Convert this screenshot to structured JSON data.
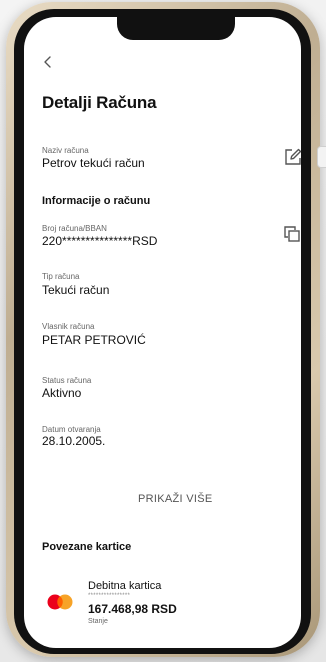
{
  "header": {
    "title": "Detalji Računa"
  },
  "account_name": {
    "label": "Naziv računa",
    "value": "Petrov tekući račun"
  },
  "info_section": {
    "title": "Informacije o računu",
    "fields": [
      {
        "label": "Broj računa/BBAN",
        "value": "220***************RSD"
      },
      {
        "label": "Tip računa",
        "value": "Tekući račun"
      },
      {
        "label": "Vlasnik računa",
        "value": "PETAR PETROVIĆ"
      },
      {
        "label": "Status računa",
        "value": "Aktivno"
      },
      {
        "label": "Datum otvaranja",
        "value": "28.10.2005."
      }
    ]
  },
  "show_more_label": "PRIKAŽI VIŠE",
  "linked_cards": {
    "title": "Povezane kartice",
    "cards": [
      {
        "name": "Debitna kartica",
        "masked_number": "****************",
        "amount": "167.468,98 RSD",
        "status": "Stanje",
        "icon": "mastercard-logo-icon"
      }
    ]
  },
  "icons": {
    "back": "chevron-left-icon",
    "edit": "edit-icon",
    "copy": "copy-icon"
  },
  "colors": {
    "mastercard_red": "#eb001b",
    "mastercard_orange": "#f79e1b"
  }
}
